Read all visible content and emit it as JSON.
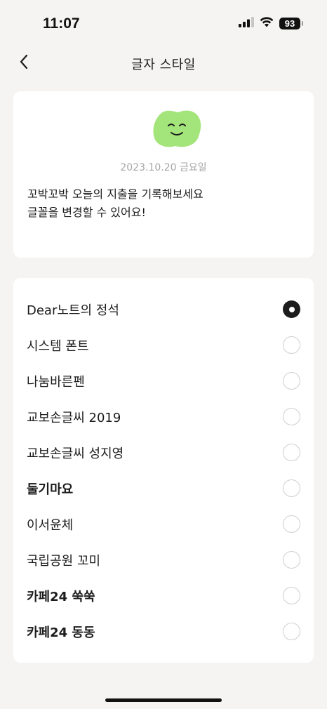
{
  "status_bar": {
    "time": "11:07",
    "battery_level": "93",
    "icons": [
      "signal-icon",
      "wifi-icon",
      "battery-icon"
    ]
  },
  "nav": {
    "title": "글자 스타일",
    "back_icon": "chevron-left-icon"
  },
  "preview": {
    "mascot_icon": "green-smiling-blob-mascot",
    "mascot_color": "#a4e57b",
    "date": "2023.10.20 금요일",
    "text_line1": "꼬박꼬박 오늘의 지출을 기록해보세요",
    "text_line2": "글꼴을 변경할 수 있어요!"
  },
  "fonts": [
    {
      "name": "Dear노트의 정석",
      "selected": true,
      "bold": false
    },
    {
      "name": "시스템 폰트",
      "selected": false,
      "bold": false
    },
    {
      "name": "나눔바른펜",
      "selected": false,
      "bold": false
    },
    {
      "name": "교보손글씨 2019",
      "selected": false,
      "bold": false
    },
    {
      "name": "교보손글씨 성지영",
      "selected": false,
      "bold": false
    },
    {
      "name": "둘기마요",
      "selected": false,
      "bold": true
    },
    {
      "name": "이서윤체",
      "selected": false,
      "bold": false
    },
    {
      "name": "국립공원 꼬미",
      "selected": false,
      "bold": false
    },
    {
      "name": "카페24 쑥쑥",
      "selected": false,
      "bold": true
    },
    {
      "name": "카페24 동동",
      "selected": false,
      "bold": true
    }
  ],
  "colors": {
    "background": "#f5f4f3",
    "card": "#ffffff",
    "selected_radio": "#1c1c1c",
    "unselected_radio_border": "#cfcfcf",
    "date_text": "#a5a5a5"
  }
}
